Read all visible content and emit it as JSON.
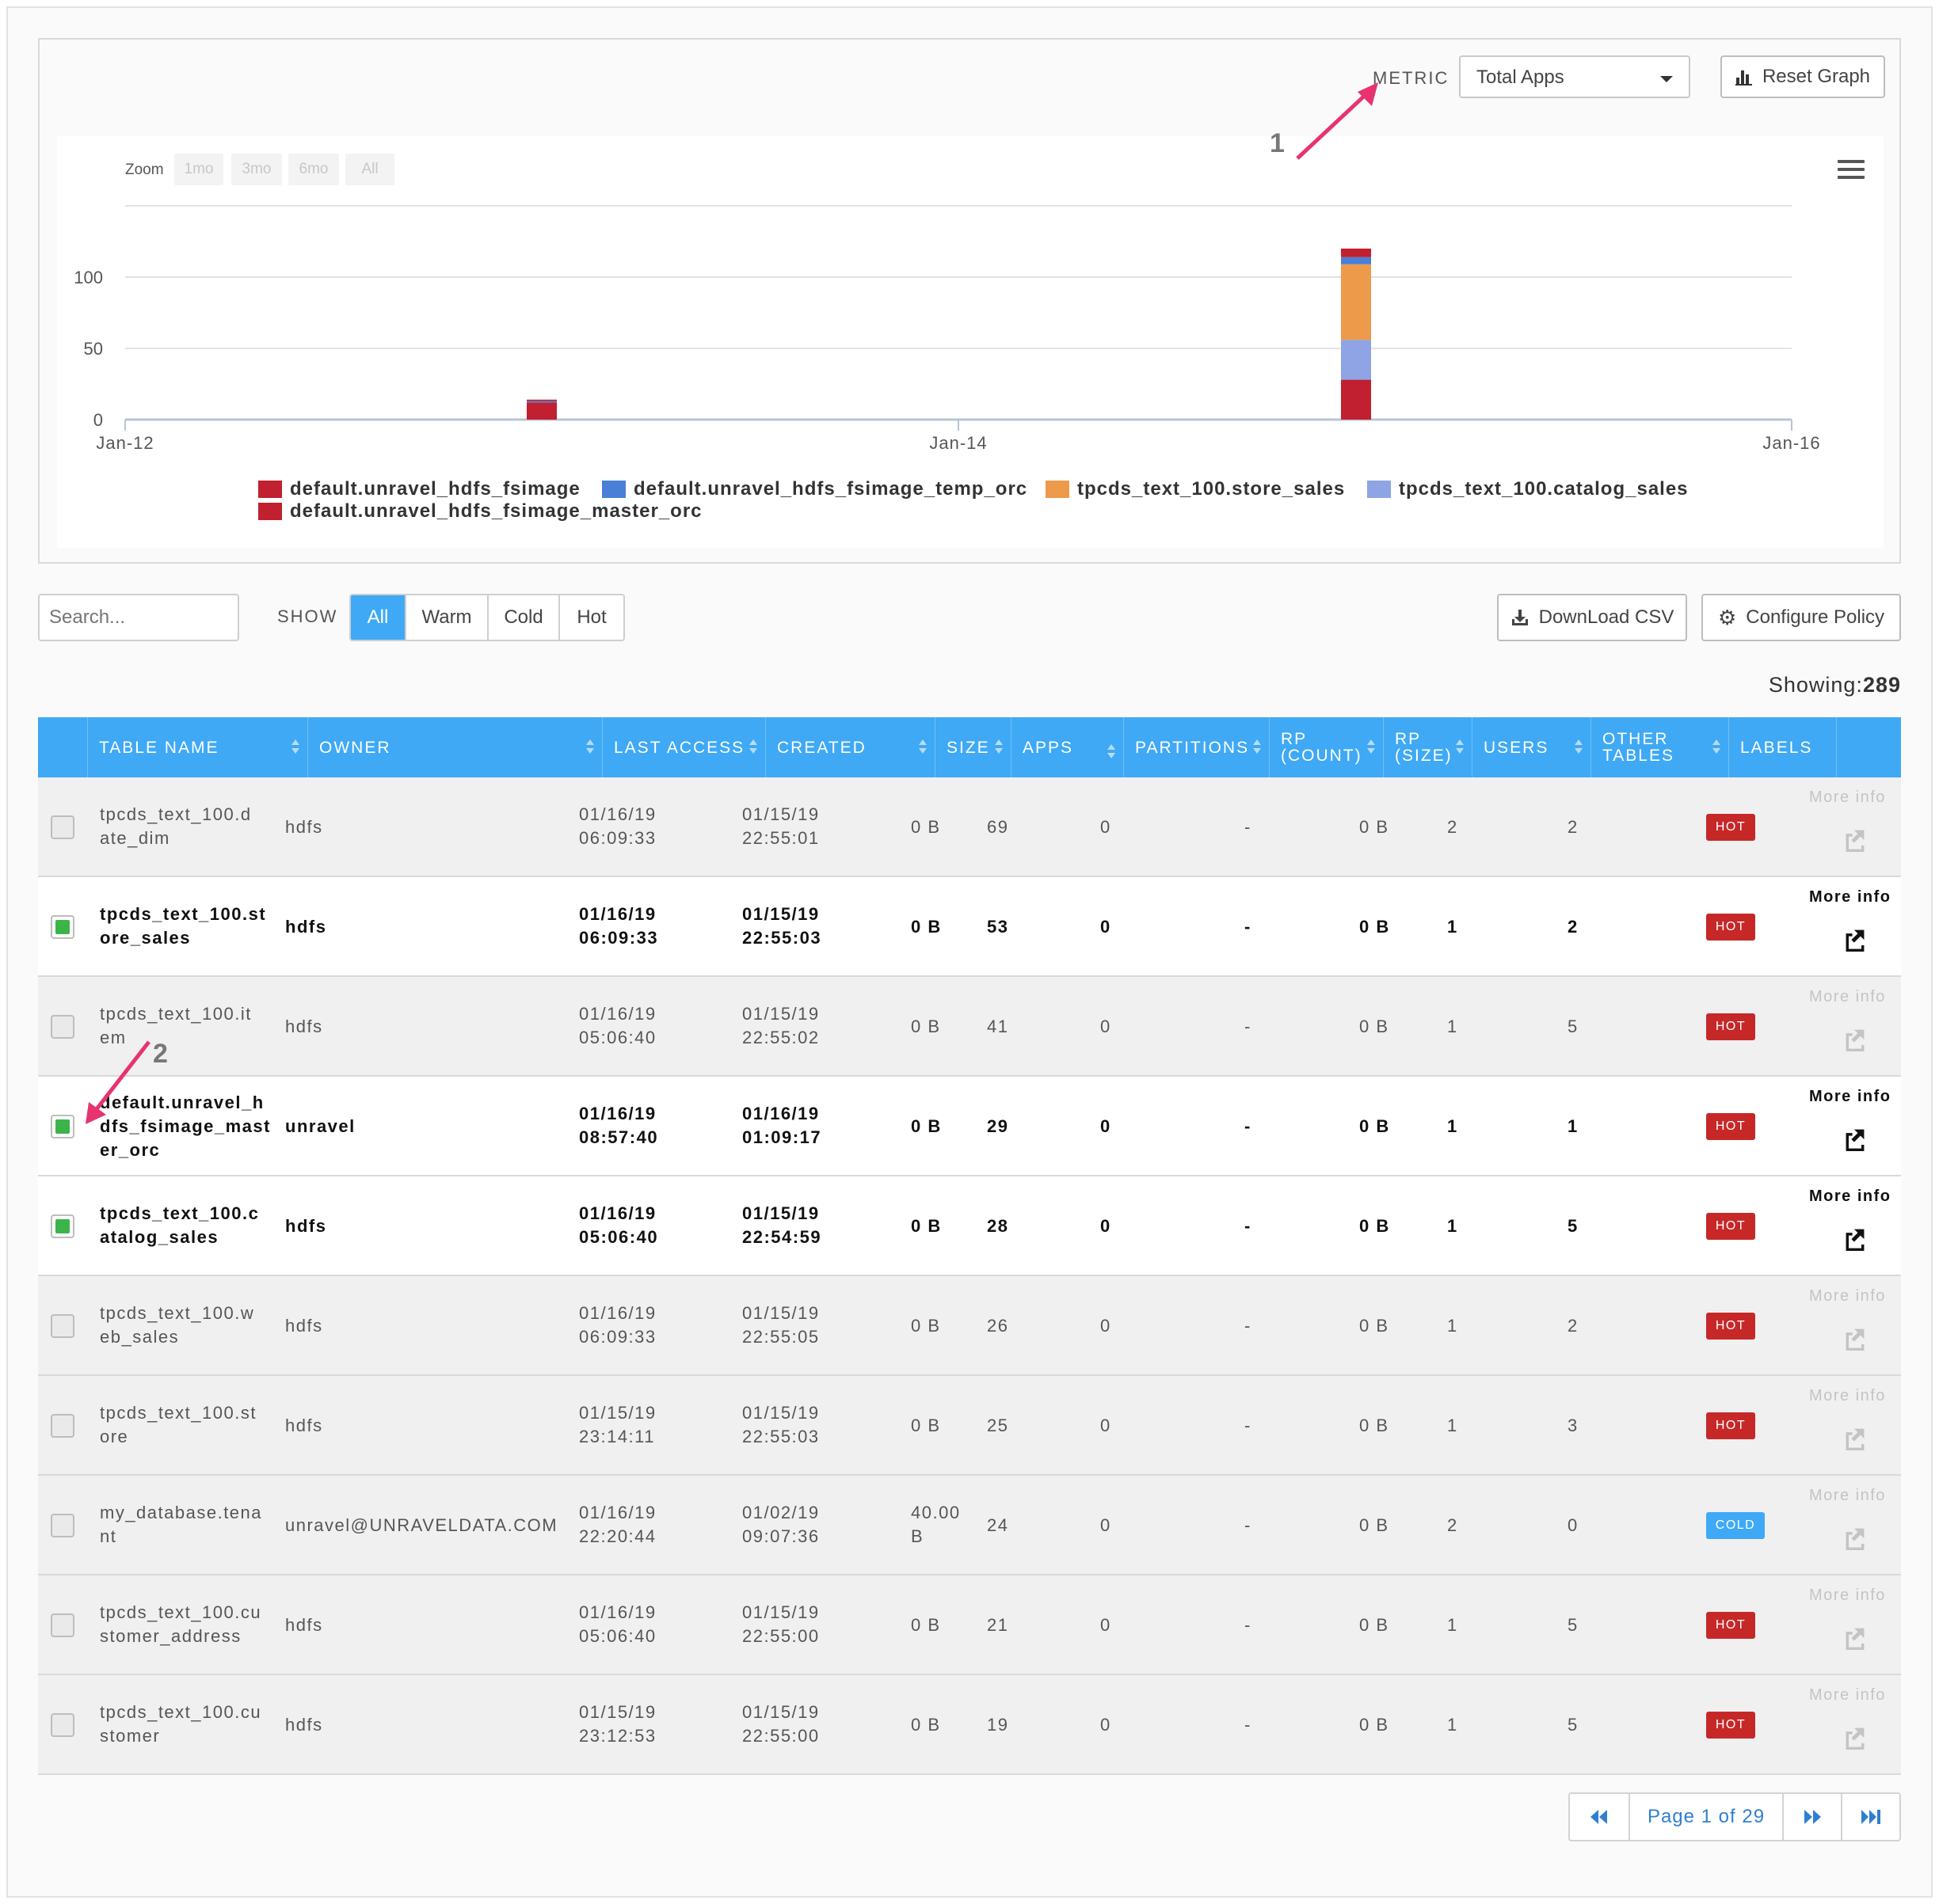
{
  "header": {
    "metric_label": "METRIC",
    "metric_value": "Total Apps",
    "reset_label": "Reset Graph"
  },
  "chart": {
    "zoom_label": "Zoom",
    "zoom_options": [
      "1mo",
      "3mo",
      "6mo",
      "All"
    ],
    "annotation_1": "1",
    "annotation_2": "2"
  },
  "chart_data": {
    "type": "bar",
    "stacked": true,
    "x_ticks": [
      "Jan-12",
      "Jan-14",
      "Jan-16"
    ],
    "y_ticks": [
      0,
      50,
      100
    ],
    "ylim": [
      0,
      150
    ],
    "grid": true,
    "legend_position": "bottom",
    "categories": [
      "Jan-13",
      "Jan-15"
    ],
    "series": [
      {
        "name": "default.unravel_hdfs_fsimage",
        "color": "#c0202f",
        "values": [
          12,
          28
        ]
      },
      {
        "name": "default.unravel_hdfs_fsimage_temp_orc",
        "color": "#4a7fd8",
        "values": [
          1,
          5
        ]
      },
      {
        "name": "tpcds_text_100.store_sales",
        "color": "#ee9a4b",
        "values": [
          0,
          53
        ]
      },
      {
        "name": "tpcds_text_100.catalog_sales",
        "color": "#8ea4e4",
        "values": [
          0,
          28
        ]
      },
      {
        "name": "default.unravel_hdfs_fsimage_master_orc",
        "color": "#c0202f",
        "values": [
          1,
          6
        ]
      }
    ]
  },
  "toolbar": {
    "search_placeholder": "Search...",
    "show_label": "SHOW",
    "filters": [
      "All",
      "Warm",
      "Cold",
      "Hot"
    ],
    "active_filter": "All",
    "download_csv": "DownLoad CSV",
    "configure_policy": "Configure Policy",
    "showing_label": "Showing:",
    "showing_count": "289"
  },
  "table": {
    "columns": [
      {
        "l1": "TABLE NAME",
        "l2": ""
      },
      {
        "l1": "OWNER",
        "l2": ""
      },
      {
        "l1": "LAST ACCESS",
        "l2": ""
      },
      {
        "l1": "CREATED",
        "l2": ""
      },
      {
        "l1": "SIZE",
        "l2": ""
      },
      {
        "l1": "APPS",
        "l2": ""
      },
      {
        "l1": "PARTITIONS",
        "l2": ""
      },
      {
        "l1": "RP",
        "l2": "(COUNT)"
      },
      {
        "l1": "RP",
        "l2": "(SIZE)"
      },
      {
        "l1": "USERS",
        "l2": ""
      },
      {
        "l1": "OTHER",
        "l2": "TABLES"
      },
      {
        "l1": "LABELS",
        "l2": ""
      }
    ],
    "more_info": "More info",
    "rows": [
      {
        "selected": false,
        "name1": "tpcds_text_100.d",
        "name2": "ate_dim",
        "name3": "",
        "owner": "hdfs",
        "last1": "01/16/19",
        "last2": "06:09:33",
        "created1": "01/15/19",
        "created2": "22:55:01",
        "size1": "0 B",
        "size2": "",
        "apps": "69",
        "partitions": "0",
        "rp_count": "-",
        "rp_size": "0 B",
        "users": "2",
        "other": "2",
        "label": "HOT"
      },
      {
        "selected": true,
        "name1": "tpcds_text_100.st",
        "name2": "ore_sales",
        "name3": "",
        "owner": "hdfs",
        "last1": "01/16/19",
        "last2": "06:09:33",
        "created1": "01/15/19",
        "created2": "22:55:03",
        "size1": "0 B",
        "size2": "",
        "apps": "53",
        "partitions": "0",
        "rp_count": "-",
        "rp_size": "0 B",
        "users": "1",
        "other": "2",
        "label": "HOT"
      },
      {
        "selected": false,
        "name1": "tpcds_text_100.it",
        "name2": "em",
        "name3": "",
        "owner": "hdfs",
        "last1": "01/16/19",
        "last2": "05:06:40",
        "created1": "01/15/19",
        "created2": "22:55:02",
        "size1": "0 B",
        "size2": "",
        "apps": "41",
        "partitions": "0",
        "rp_count": "-",
        "rp_size": "0 B",
        "users": "1",
        "other": "5",
        "label": "HOT"
      },
      {
        "selected": true,
        "name1": "default.unravel_h",
        "name2": "dfs_fsimage_mast",
        "name3": "er_orc",
        "owner": "unravel",
        "last1": "01/16/19",
        "last2": "08:57:40",
        "created1": "01/16/19",
        "created2": "01:09:17",
        "size1": "0 B",
        "size2": "",
        "apps": "29",
        "partitions": "0",
        "rp_count": "-",
        "rp_size": "0 B",
        "users": "1",
        "other": "1",
        "label": "HOT"
      },
      {
        "selected": true,
        "name1": "tpcds_text_100.c",
        "name2": "atalog_sales",
        "name3": "",
        "owner": "hdfs",
        "last1": "01/16/19",
        "last2": "05:06:40",
        "created1": "01/15/19",
        "created2": "22:54:59",
        "size1": "0 B",
        "size2": "",
        "apps": "28",
        "partitions": "0",
        "rp_count": "-",
        "rp_size": "0 B",
        "users": "1",
        "other": "5",
        "label": "HOT"
      },
      {
        "selected": false,
        "name1": "tpcds_text_100.w",
        "name2": "eb_sales",
        "name3": "",
        "owner": "hdfs",
        "last1": "01/16/19",
        "last2": "06:09:33",
        "created1": "01/15/19",
        "created2": "22:55:05",
        "size1": "0 B",
        "size2": "",
        "apps": "26",
        "partitions": "0",
        "rp_count": "-",
        "rp_size": "0 B",
        "users": "1",
        "other": "2",
        "label": "HOT"
      },
      {
        "selected": false,
        "name1": "tpcds_text_100.st",
        "name2": "ore",
        "name3": "",
        "owner": "hdfs",
        "last1": "01/15/19",
        "last2": "23:14:11",
        "created1": "01/15/19",
        "created2": "22:55:03",
        "size1": "0 B",
        "size2": "",
        "apps": "25",
        "partitions": "0",
        "rp_count": "-",
        "rp_size": "0 B",
        "users": "1",
        "other": "3",
        "label": "HOT"
      },
      {
        "selected": false,
        "name1": "my_database.tena",
        "name2": "nt",
        "name3": "",
        "owner": "unravel@UNRAVELDATA.COM",
        "last1": "01/16/19",
        "last2": "22:20:44",
        "created1": "01/02/19",
        "created2": "09:07:36",
        "size1": "40.00",
        "size2": "B",
        "apps": "24",
        "partitions": "0",
        "rp_count": "-",
        "rp_size": "0 B",
        "users": "2",
        "other": "0",
        "label": "COLD"
      },
      {
        "selected": false,
        "name1": "tpcds_text_100.cu",
        "name2": "stomer_address",
        "name3": "",
        "owner": "hdfs",
        "last1": "01/16/19",
        "last2": "05:06:40",
        "created1": "01/15/19",
        "created2": "22:55:00",
        "size1": "0 B",
        "size2": "",
        "apps": "21",
        "partitions": "0",
        "rp_count": "-",
        "rp_size": "0 B",
        "users": "1",
        "other": "5",
        "label": "HOT"
      },
      {
        "selected": false,
        "name1": "tpcds_text_100.cu",
        "name2": "stomer",
        "name3": "",
        "owner": "hdfs",
        "last1": "01/15/19",
        "last2": "23:12:53",
        "created1": "01/15/19",
        "created2": "22:55:00",
        "size1": "0 B",
        "size2": "",
        "apps": "19",
        "partitions": "0",
        "rp_count": "-",
        "rp_size": "0 B",
        "users": "1",
        "other": "5",
        "label": "HOT"
      }
    ]
  },
  "pager": {
    "page_text": "Page 1 of 29"
  },
  "icons": {
    "reset": "bar-chart-icon",
    "csv": "download-icon",
    "policy": "gear-icon",
    "row_action": "external-link-icon",
    "pager": [
      "first-page-icon",
      "next-page-icon",
      "last-page-icon"
    ]
  },
  "colors": {
    "accent": "#3fa9f5",
    "hot": "#c62828",
    "cold": "#3fa9f5",
    "annotation": "#e8336f"
  }
}
